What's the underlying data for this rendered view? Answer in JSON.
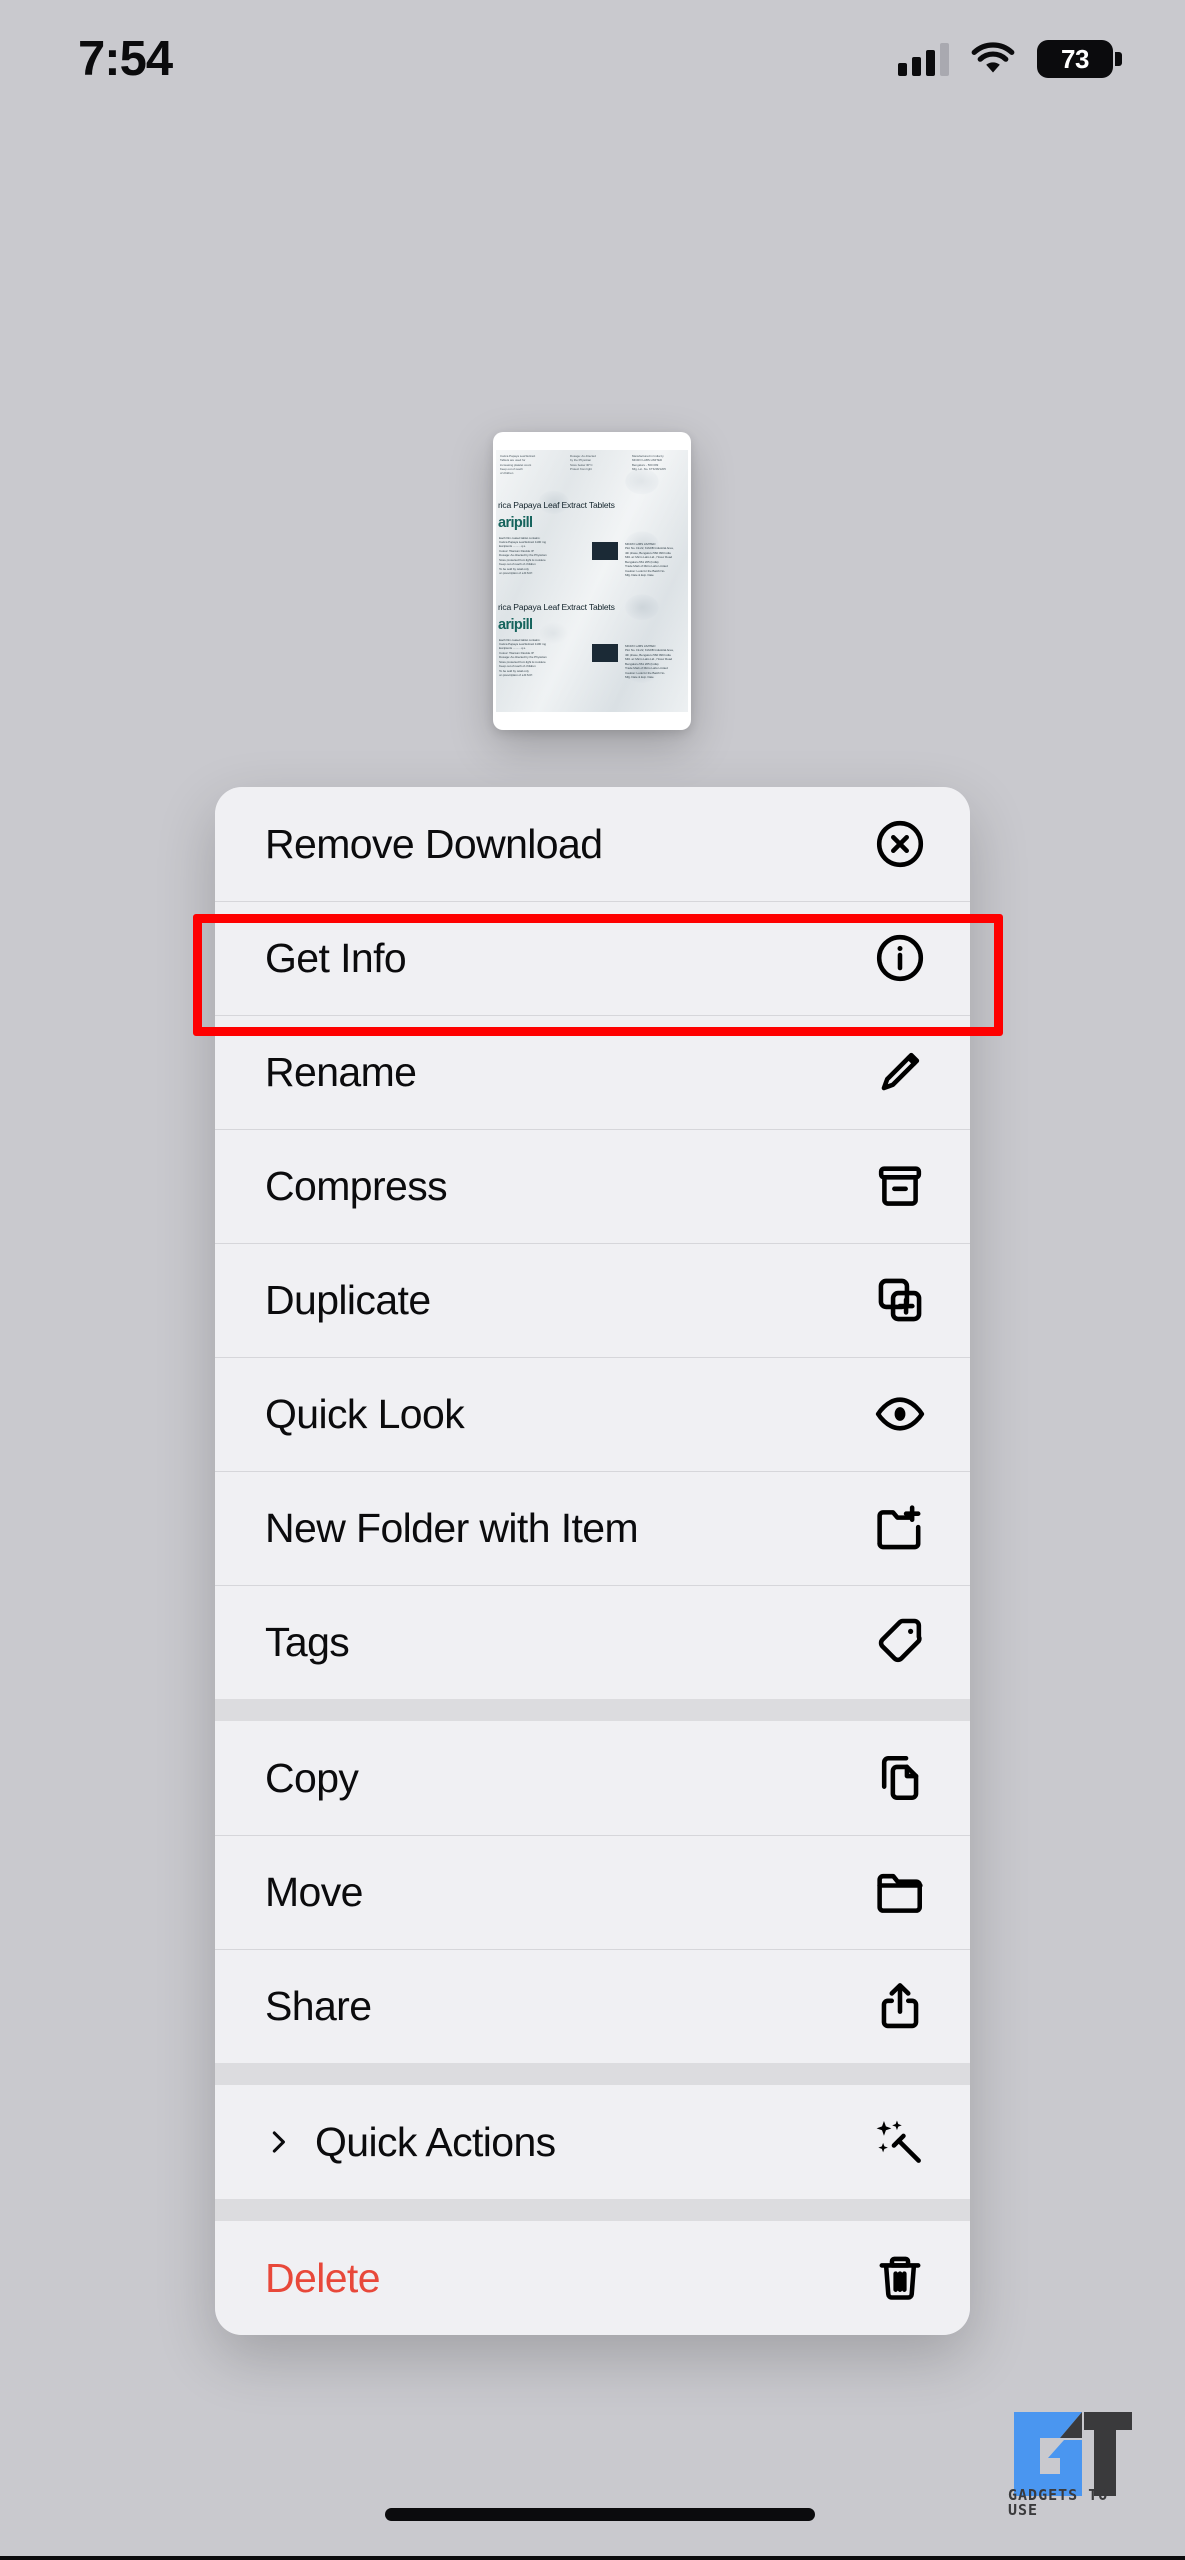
{
  "status_bar": {
    "time": "7:54",
    "battery_level": "73",
    "signal_icon": "cellular-signal-icon",
    "wifi_icon": "wifi-icon",
    "battery_icon": "battery-icon"
  },
  "preview": {
    "name": "file-preview-thumbnail",
    "product_title": "rica Papaya Leaf Extract Tablets",
    "product_title_2": "rica Papaya Leaf Extract Tablets",
    "brand": "aripill",
    "brand_2": "aripill",
    "manufacturer": "MICRO LABS LIMITED",
    "micro_text": "Each film coated tablet contains:\nCarica Papaya Leaf Extract ....... 1100 mg\nExcipients ............. q.s.\nColour: Titanium Dioxide IP\nDosage: As directed by the Physician\nStore protected from light and moisture\nKeep out of reach of children\nTo be sold by retail on the prescription\nof a Registered Medical Practitioner"
  },
  "menu": {
    "name": "file-context-menu",
    "groups": [
      {
        "items": [
          {
            "label": "Remove Download",
            "icon": "xmark-circle-icon",
            "destructive": false,
            "has_chevron": false
          },
          {
            "label": "Get Info",
            "icon": "info-circle-icon",
            "destructive": false,
            "has_chevron": false,
            "highlighted": true
          },
          {
            "label": "Rename",
            "icon": "pencil-icon",
            "destructive": false,
            "has_chevron": false
          },
          {
            "label": "Compress",
            "icon": "archivebox-icon",
            "destructive": false,
            "has_chevron": false
          },
          {
            "label": "Duplicate",
            "icon": "plus-square-on-square-icon",
            "destructive": false,
            "has_chevron": false
          },
          {
            "label": "Quick Look",
            "icon": "eye-icon",
            "destructive": false,
            "has_chevron": false
          },
          {
            "label": "New Folder with Item",
            "icon": "folder-badge-plus-icon",
            "destructive": false,
            "has_chevron": false
          },
          {
            "label": "Tags",
            "icon": "tag-icon",
            "destructive": false,
            "has_chevron": false
          }
        ]
      },
      {
        "items": [
          {
            "label": "Copy",
            "icon": "doc-on-doc-icon",
            "destructive": false,
            "has_chevron": false
          },
          {
            "label": "Move",
            "icon": "folder-icon",
            "destructive": false,
            "has_chevron": false
          },
          {
            "label": "Share",
            "icon": "share-up-icon",
            "destructive": false,
            "has_chevron": false
          }
        ]
      },
      {
        "items": [
          {
            "label": "Quick Actions",
            "icon": "wand-sparkles-icon",
            "destructive": false,
            "has_chevron": true
          }
        ]
      },
      {
        "items": [
          {
            "label": "Delete",
            "icon": "trash-icon",
            "destructive": true,
            "has_chevron": false
          }
        ]
      }
    ]
  },
  "annotation": {
    "name": "get-info-highlight-box",
    "color": "#fe0000",
    "target_label": "Get Info"
  },
  "watermark": {
    "text": "GADGETS TO USE",
    "visible_text": "GADGETS",
    "blue": "#4a96f0",
    "dark": "#3a3a3c"
  },
  "home_indicator": {
    "name": "home-indicator"
  },
  "colors": {
    "background": "#c9c9ce",
    "menu_row": "#f0f0f3",
    "menu_separator": "#dcdcdf",
    "destructive": "#e8483a",
    "text": "#0b0b0d"
  }
}
